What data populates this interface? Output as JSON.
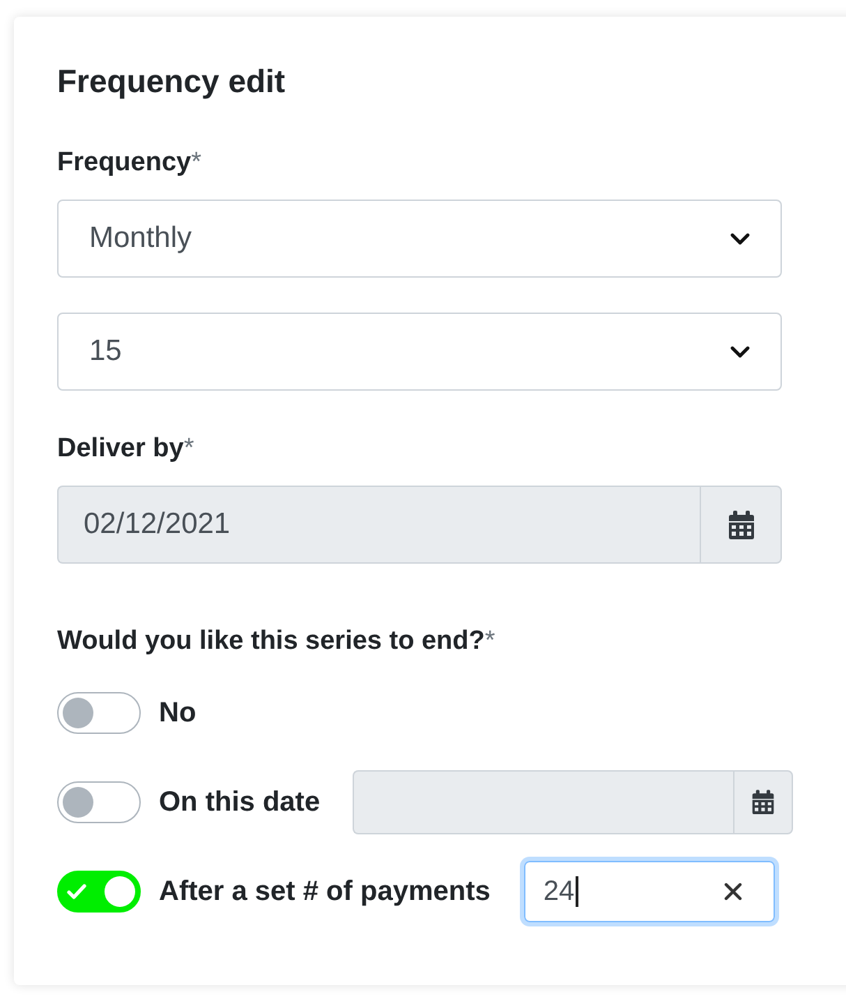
{
  "title": "Frequency edit",
  "frequency": {
    "label": "Frequency",
    "required_mark": "*",
    "selects": [
      {
        "value": "Monthly"
      },
      {
        "value": "15"
      }
    ]
  },
  "deliver_by": {
    "label": "Deliver by",
    "required_mark": "*",
    "value": "02/12/2021",
    "disabled": true
  },
  "series_end": {
    "label": "Would you like this series to end?",
    "required_mark": "*",
    "options": [
      {
        "kind": "plain",
        "label": "No",
        "on": false
      },
      {
        "kind": "date",
        "label": "On this date",
        "on": false,
        "disabled": true
      },
      {
        "kind": "count",
        "label": "After a set # of payments",
        "on": true,
        "value": "24",
        "focused": true
      }
    ]
  }
}
